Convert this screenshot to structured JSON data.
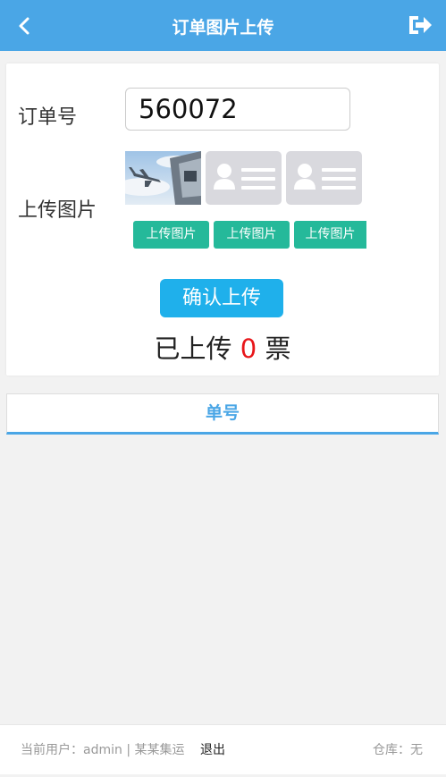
{
  "header": {
    "title": "订单图片上传",
    "back_icon": "chevron-left-icon",
    "logout_icon": "sign-out-icon",
    "background_color": "#4aa6e6"
  },
  "form": {
    "order_label": "订单号",
    "order_value": "560072",
    "upload_label": "上传图片",
    "images": [
      {
        "state": "uploaded",
        "content": "airplane-photo"
      },
      {
        "state": "empty",
        "content": "id-card-placeholder-icon"
      },
      {
        "state": "empty",
        "content": "id-card-placeholder-icon"
      }
    ],
    "upload_buttons": [
      "上传图片",
      "上传图片",
      "上传图片"
    ],
    "upload_button_color": "#25b99a",
    "confirm_button": "确认上传",
    "confirm_button_color": "#1fb0eb",
    "uploaded_prefix": "已上传",
    "uploaded_count": "0",
    "uploaded_suffix": "票",
    "count_color": "#e8161a"
  },
  "tab": {
    "label": "单号"
  },
  "footer": {
    "user_text": "当前用户：admin | 某某集运",
    "exit_label": "退出",
    "warehouse_text": "仓库：无"
  }
}
